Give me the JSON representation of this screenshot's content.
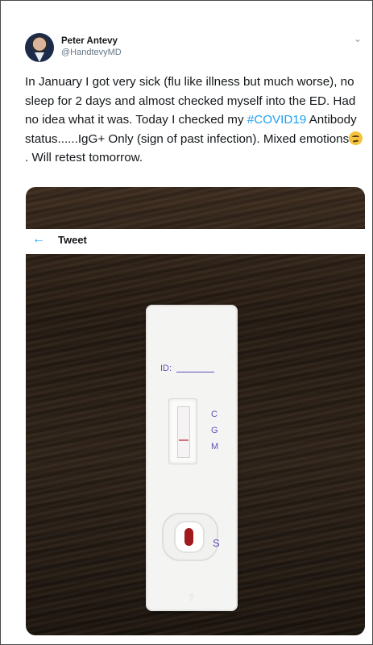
{
  "tweet": {
    "author_name": "Peter Antevy",
    "author_handle": "@HandtevyMD",
    "text_part1": "In January I got very sick (flu like illness but much worse), no sleep for 2 days and almost checked myself into the ED.  Had no idea what it was.  Today I checked my ",
    "hashtag": "#COVID19",
    "text_part2": " Antibody status......IgG+ Only (sign of past infection).  Mixed emotions",
    "text_part3": ".  Will retest tomorrow.",
    "menu_icon": "chevron-down-icon",
    "emoji_icon": "confused-face-emoji"
  },
  "overlay": {
    "back_icon": "back-arrow-icon",
    "title": "Tweet"
  },
  "test_cassette": {
    "id_label": "ID:",
    "letter_c": "C",
    "letter_g": "G",
    "letter_m": "M",
    "letter_s": "S"
  },
  "colors": {
    "link": "#1da1f2",
    "cassette_ink": "#5b54b8",
    "blood": "#a1181d"
  }
}
